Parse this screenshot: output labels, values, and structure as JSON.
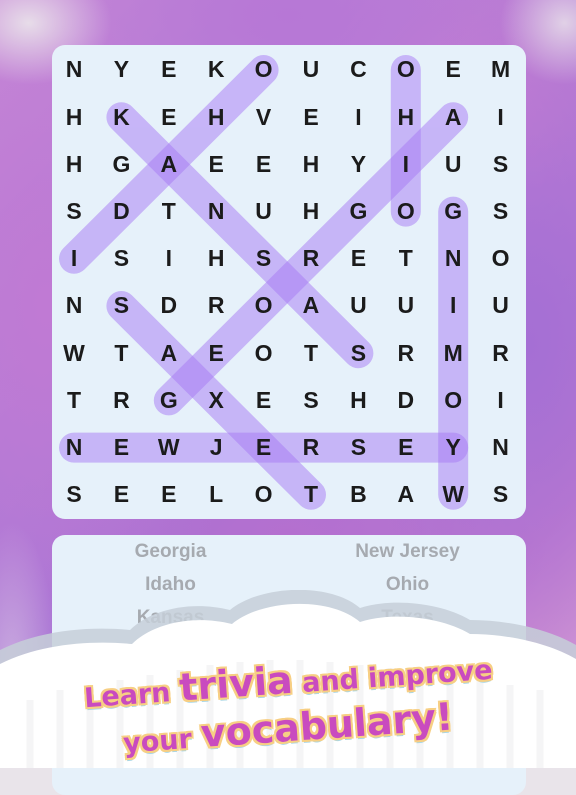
{
  "puzzle": {
    "grid": [
      [
        "N",
        "Y",
        "E",
        "K",
        "O",
        "U",
        "C",
        "O",
        "E",
        "M"
      ],
      [
        "H",
        "K",
        "E",
        "H",
        "V",
        "E",
        "I",
        "H",
        "A",
        "I"
      ],
      [
        "H",
        "G",
        "A",
        "E",
        "E",
        "H",
        "Y",
        "I",
        "U",
        "S"
      ],
      [
        "S",
        "D",
        "T",
        "N",
        "U",
        "H",
        "G",
        "O",
        "G",
        "S"
      ],
      [
        "I",
        "S",
        "I",
        "H",
        "S",
        "R",
        "E",
        "T",
        "N",
        "O"
      ],
      [
        "N",
        "S",
        "D",
        "R",
        "O",
        "A",
        "U",
        "U",
        "I",
        "U"
      ],
      [
        "W",
        "T",
        "A",
        "E",
        "O",
        "T",
        "S",
        "R",
        "M",
        "R"
      ],
      [
        "T",
        "R",
        "G",
        "X",
        "E",
        "S",
        "H",
        "D",
        "O",
        "I"
      ],
      [
        "N",
        "E",
        "W",
        "J",
        "E",
        "R",
        "S",
        "E",
        "Y",
        "N"
      ],
      [
        "S",
        "E",
        "E",
        "L",
        "O",
        "T",
        "B",
        "A",
        "W",
        "S"
      ]
    ],
    "found_words": [
      {
        "word": "Idaho",
        "start": [
          4,
          0
        ],
        "end": [
          0,
          4
        ]
      },
      {
        "word": "Kansas",
        "start": [
          1,
          1
        ],
        "end": [
          6,
          6
        ]
      },
      {
        "word": "Ohio",
        "start": [
          0,
          7
        ],
        "end": [
          3,
          7
        ]
      },
      {
        "word": "Georgia",
        "start": [
          7,
          2
        ],
        "end": [
          1,
          8
        ]
      },
      {
        "word": "Wyoming",
        "start": [
          9,
          8
        ],
        "end": [
          3,
          8
        ]
      },
      {
        "word": "New Jersey",
        "start": [
          8,
          0
        ],
        "end": [
          8,
          8
        ]
      },
      {
        "word": "Texas",
        "start": [
          9,
          5
        ],
        "end": [
          5,
          1
        ]
      }
    ],
    "highlight_color": "#a77bf5"
  },
  "word_list": {
    "items": [
      {
        "label": "Georgia",
        "found": true
      },
      {
        "label": "New Jersey",
        "found": true
      },
      {
        "label": "Idaho",
        "found": true
      },
      {
        "label": "Ohio",
        "found": true
      },
      {
        "label": "Kansas",
        "found": true
      },
      {
        "label": "Texas",
        "found": true
      }
    ]
  },
  "banner": {
    "line1_a": "Learn ",
    "line1_b": "trivia",
    "line1_c": " and improve",
    "line2_a": "your ",
    "line2_b": "vocabulary!",
    "text_color": "#c94bbf",
    "outline_color": "#f7cf84"
  }
}
